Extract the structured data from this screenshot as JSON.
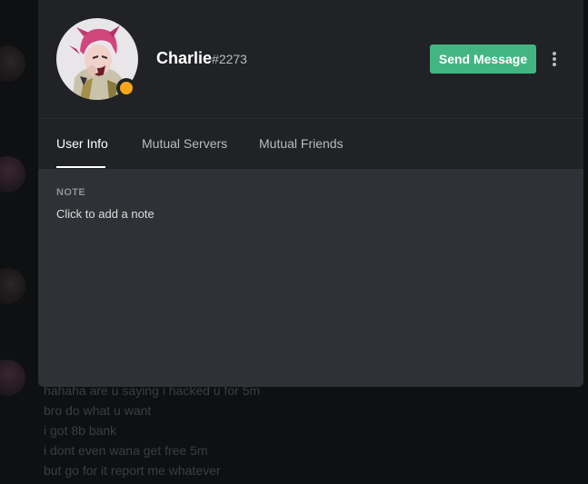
{
  "profile": {
    "username": "Charlie",
    "discriminator": "#2273",
    "status": "idle",
    "send_message_label": "Send Message"
  },
  "tabs": [
    {
      "label": "User Info",
      "active": true
    },
    {
      "label": "Mutual Servers",
      "active": false
    },
    {
      "label": "Mutual Friends",
      "active": false
    }
  ],
  "note": {
    "label": "NOTE",
    "placeholder": "Click to add a note"
  },
  "background_chat": {
    "lines": [
      "hahaha are u saying i hacked u for 5m",
      "bro do what u want",
      "i got 8b bank",
      "i dont even wana get free 5m",
      "but go for it report me whatever"
    ]
  },
  "colors": {
    "accent_green": "#43b581",
    "status_idle": "#faa61a",
    "modal_header": "#202225",
    "modal_body": "#2f3136"
  },
  "icons": {
    "more": "vertical-ellipsis",
    "status": "idle-dot"
  }
}
